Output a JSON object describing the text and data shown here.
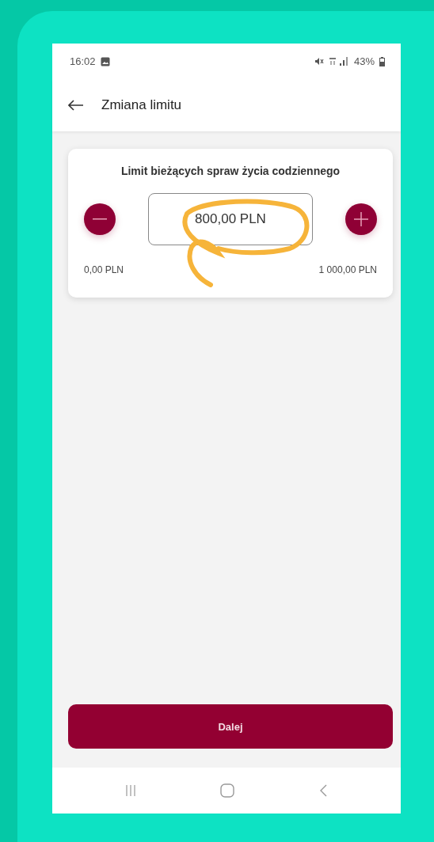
{
  "status_bar": {
    "time": "16:02",
    "battery": "43%"
  },
  "header": {
    "title": "Zmiana limitu"
  },
  "limit_card": {
    "title": "Limit bieżących spraw życia codziennego",
    "value": "800,00 PLN",
    "min_label": "0,00 PLN",
    "max_label": "1 000,00 PLN"
  },
  "next_button": {
    "label": "Dalej"
  }
}
